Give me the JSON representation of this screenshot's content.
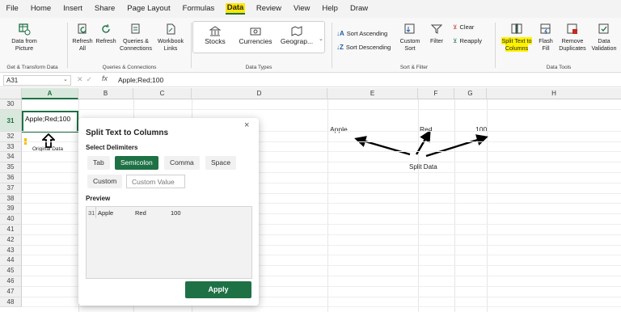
{
  "menu": [
    "File",
    "Home",
    "Insert",
    "Share",
    "Page Layout",
    "Formulas",
    "Data",
    "Review",
    "View",
    "Help",
    "Draw"
  ],
  "active_menu": "Data",
  "ribbon": {
    "get_transform": {
      "data_from_picture": [
        "Data from",
        "Picture"
      ],
      "title": "Get & Transform Data"
    },
    "queries": {
      "refresh_all": [
        "Refresh",
        "All"
      ],
      "refresh": [
        "Refresh",
        ""
      ],
      "queries_connections": [
        "Queries &",
        "Connections"
      ],
      "workbook_links": [
        "Workbook",
        "Links"
      ],
      "title": "Queries & Connections"
    },
    "data_types": {
      "stocks": "Stocks",
      "currencies": "Currencies",
      "geography": "Geograp...",
      "title": "Data Types"
    },
    "sort_filter": {
      "sort_asc": "Sort Ascending",
      "sort_desc": "Sort Descending",
      "custom_sort": [
        "Custom",
        "Sort"
      ],
      "filter": "Filter",
      "clear": "Clear",
      "reapply": "Reapply",
      "title": "Sort & Filter"
    },
    "data_tools": {
      "split": [
        "Split Text to",
        "Columns"
      ],
      "flash_fill": [
        "Flash",
        "Fill"
      ],
      "remove_dup": [
        "Remove",
        "Duplicates"
      ],
      "validation": [
        "Data",
        "Validation"
      ],
      "title": "Data Tools"
    }
  },
  "formula_bar": {
    "name_box": "A31",
    "fx": "fx",
    "content": "Apple;Red;100"
  },
  "columns": [
    "A",
    "B",
    "C",
    "D",
    "E",
    "F",
    "G",
    "H"
  ],
  "rows": [
    "30",
    "31",
    "32",
    "33",
    "34",
    "35",
    "36",
    "37",
    "38",
    "39",
    "40",
    "41",
    "42",
    "43",
    "44",
    "45",
    "46",
    "47",
    "48"
  ],
  "selected_column": "A",
  "selected_row": "31",
  "cells": {
    "a31": "Apple;Red;100",
    "e31": "Apple",
    "f31": "Red",
    "g31": "100"
  },
  "annotations": {
    "original_data": "Original Data",
    "split_data": "Split Data"
  },
  "dialog": {
    "title": "Split Text to Columns",
    "delimiters_label": "Select Delimiters",
    "delimiters": [
      "Tab",
      "Semicolon",
      "Comma",
      "Space",
      "Custom"
    ],
    "selected_delimiter": "Semicolon",
    "custom_placeholder": "Custom Value",
    "preview_label": "Preview",
    "preview_row": [
      "31",
      "Apple",
      "Red",
      "100"
    ],
    "apply_label": "Apply",
    "close_icon": "close-icon"
  },
  "colors": {
    "accent": "#1e7145",
    "highlight": "#fff200"
  }
}
